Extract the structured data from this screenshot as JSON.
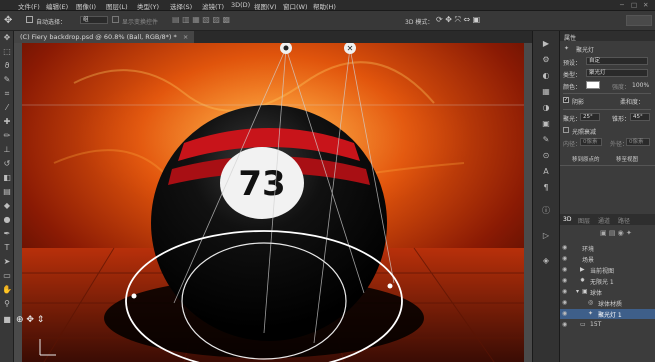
{
  "menu": [
    "文件(F)",
    "编辑(E)",
    "图像(I)",
    "图层(L)",
    "类型(Y)",
    "选择(S)",
    "滤镜(T)",
    "3D(D)",
    "视图(V)",
    "窗口(W)",
    "帮助(H)"
  ],
  "options": {
    "auto_select_label": "自动选择：",
    "auto_select_value": "组",
    "transform_label": "显示变换控件",
    "mode_3d_label": "3D 模式："
  },
  "document_tab": "(C) Fiery backdrop.psd @ 60.8% (Ball, RGB/8*) *",
  "canvas": {
    "ball_number": "73"
  },
  "properties": {
    "panel_title": "属性",
    "light_header": "聚光灯",
    "preset_label": "预设：",
    "preset_value": "自定",
    "type_label": "类型：",
    "type_value": "聚光灯",
    "color_label": "颜色：",
    "intensity_label": "强度：",
    "intensity_value": "100%",
    "shadow_label": "阴影",
    "softness_label": "柔和度：",
    "hotspot_label": "聚光：",
    "hotspot_value": "25°",
    "falloff_label": "锥形：",
    "falloff_value": "45°",
    "light_falloff_label": "光照衰减",
    "inner_label": "内径：",
    "inner_value": "0像素",
    "outer_label": "外径：",
    "outer_value": "0像素",
    "origin_button": "移到原点的",
    "move_button": "移至视图"
  },
  "panel3d": {
    "tabs": [
      "3D",
      "图层",
      "通道",
      "路径"
    ],
    "items": [
      {
        "label": "环境",
        "indent": 0
      },
      {
        "label": "场景",
        "indent": 0
      },
      {
        "label": "当前视图",
        "indent": 1
      },
      {
        "label": "无限光 1",
        "indent": 1
      },
      {
        "label": "球体",
        "indent": 1
      },
      {
        "label": "球体材质",
        "indent": 2
      },
      {
        "label": "聚光灯 1",
        "indent": 2
      },
      {
        "label": "15T",
        "indent": 1
      }
    ]
  }
}
